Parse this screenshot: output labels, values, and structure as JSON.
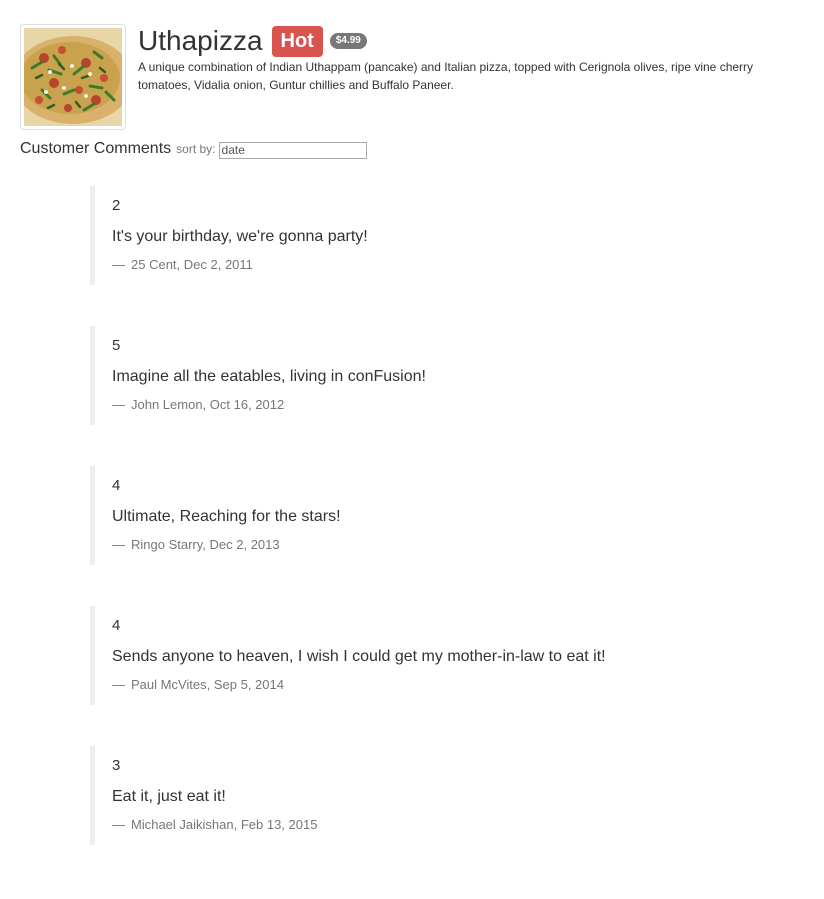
{
  "dish": {
    "image_icon": "pizza-image",
    "name": "Uthapizza",
    "label": "Hot",
    "price": "$4.99",
    "description": "A unique combination of Indian Uthappam (pancake) and Italian pizza, topped with Cerignola olives, ripe vine cherry tomatoes, Vidalia onion, Guntur chillies and Buffalo Paneer."
  },
  "comments_section": {
    "title": "Customer Comments",
    "sort_label": "sort by:",
    "sort_value": "date"
  },
  "comments": [
    {
      "rating": "2",
      "comment": "It's your birthday, we're gonna party!",
      "dash": "—",
      "byline": "25 Cent, Dec 2, 2011"
    },
    {
      "rating": "5",
      "comment": "Imagine all the eatables, living in conFusion!",
      "dash": "—",
      "byline": "John Lemon, Oct 16, 2012"
    },
    {
      "rating": "4",
      "comment": "Ultimate, Reaching for the stars!",
      "dash": "—",
      "byline": "Ringo Starry, Dec 2, 2013"
    },
    {
      "rating": "4",
      "comment": "Sends anyone to heaven, I wish I could get my mother-in-law to eat it!",
      "dash": "—",
      "byline": "Paul McVites, Sep 5, 2014"
    },
    {
      "rating": "3",
      "comment": "Eat it, just eat it!",
      "dash": "—",
      "byline": "Michael Jaikishan, Feb 13, 2015"
    }
  ],
  "colors": {
    "hot_label": "#d9534f",
    "price_badge": "#777777",
    "comment_border": "#eeeeee",
    "muted_text": "#777777"
  }
}
